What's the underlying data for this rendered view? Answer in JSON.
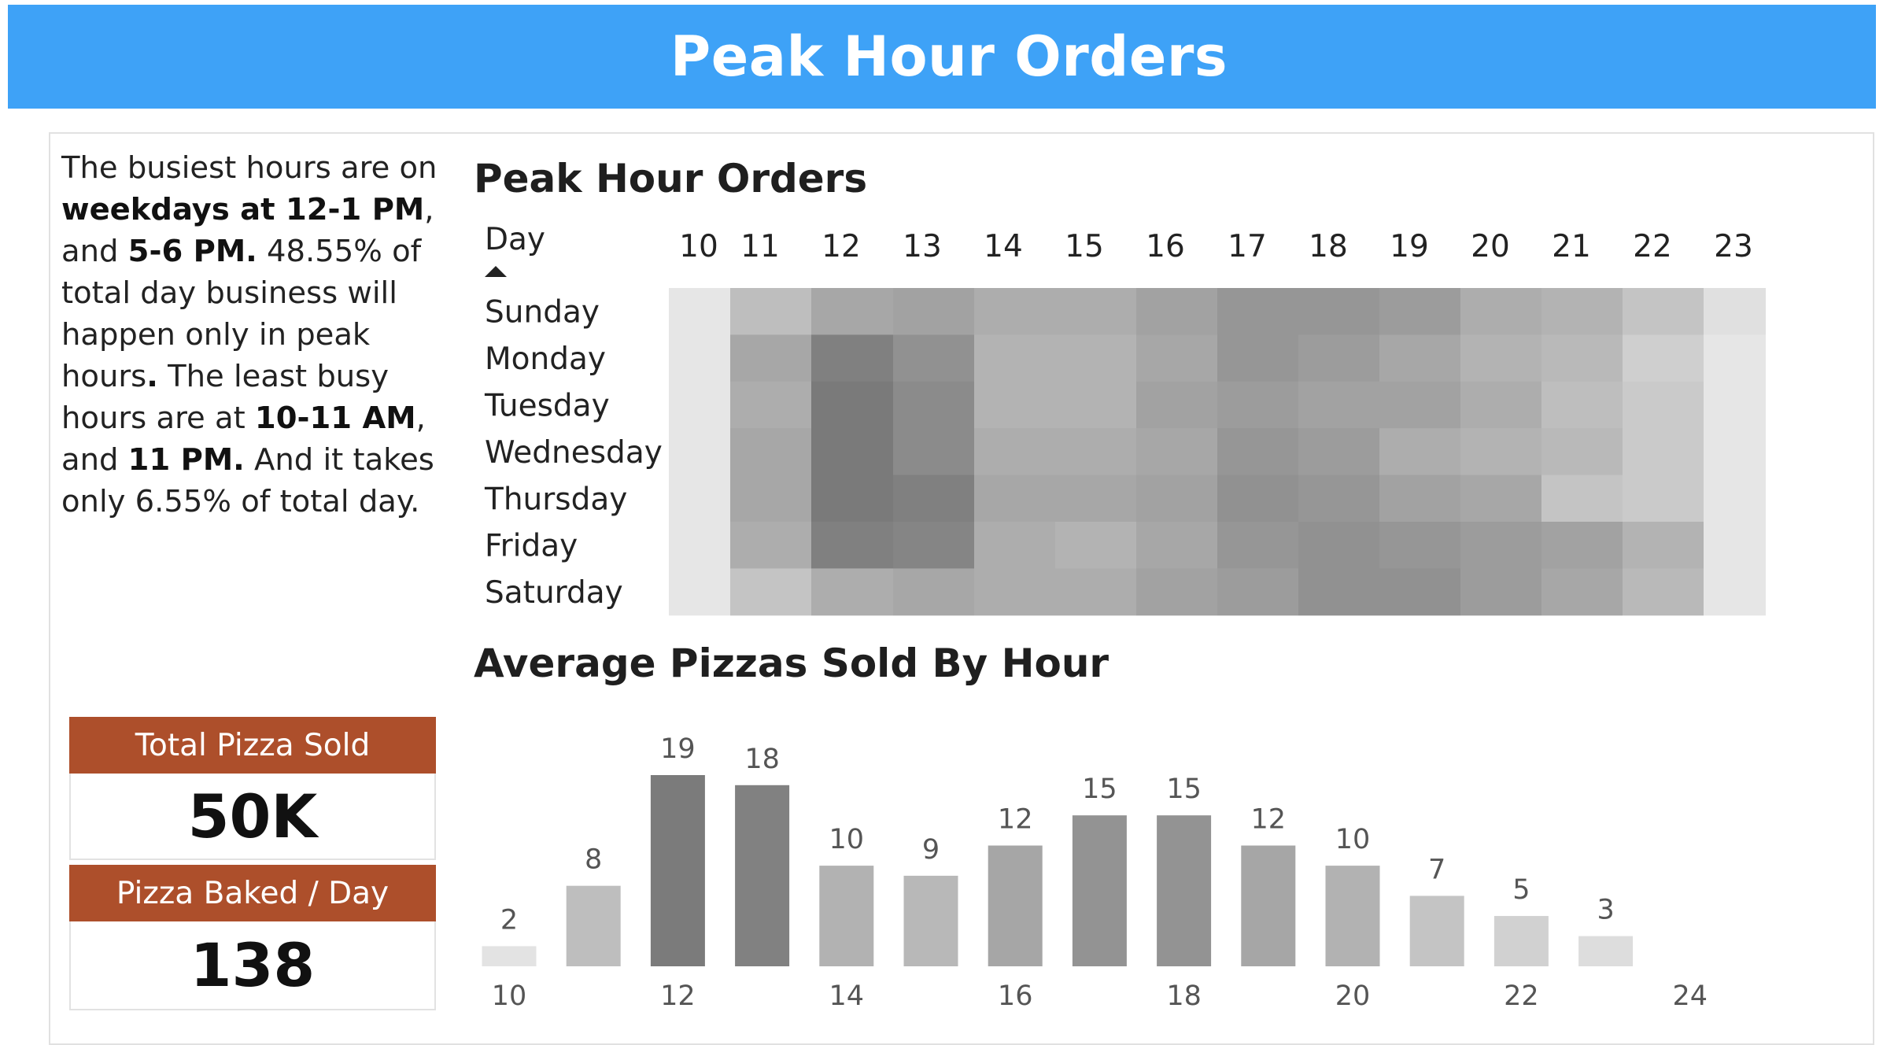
{
  "header": {
    "title": "Peak Hour Orders"
  },
  "insight": {
    "p1": "The busiest hours are on ",
    "b1": "weekdays at 12-1 PM",
    "p2": ", and ",
    "b2": "5-6 PM.",
    "p3": " 48.55% of total day business will happen only in peak hours",
    "b3": ".",
    "p4": " The least busy hours are at ",
    "b4": "10-11 AM",
    "p5": ", and ",
    "b5": "11 PM.",
    "p6": " And it takes only  6.55% of total day."
  },
  "kpis": [
    {
      "label": "Total Pizza Sold",
      "value": "50K"
    },
    {
      "label": "Pizza Baked / Day",
      "value": "138"
    }
  ],
  "chart_data": [
    {
      "type": "heatmap",
      "title": "Peak Hour Orders",
      "row_header": "Day",
      "sort": "ascending",
      "columns": [
        "10",
        "11",
        "12",
        "13",
        "14",
        "15",
        "16",
        "17",
        "18",
        "19",
        "20",
        "21",
        "22",
        "23"
      ],
      "rows": [
        "Sunday",
        "Monday",
        "Tuesday",
        "Wednesday",
        "Thursday",
        "Friday",
        "Saturday"
      ],
      "values": [
        [
          0.5,
          4.0,
          6.0,
          6.5,
          5.5,
          5.5,
          6.5,
          7.5,
          7.5,
          7.0,
          5.5,
          5.0,
          3.5,
          1.0
        ],
        [
          0.5,
          6.0,
          9.5,
          8.0,
          5.0,
          5.0,
          6.0,
          7.5,
          7.0,
          6.0,
          5.0,
          4.5,
          2.5,
          0.5
        ],
        [
          0.5,
          5.5,
          10.0,
          8.5,
          5.0,
          5.0,
          6.5,
          7.0,
          6.5,
          6.5,
          5.5,
          4.0,
          3.0,
          0.5
        ],
        [
          0.5,
          6.0,
          10.0,
          8.5,
          5.5,
          5.5,
          6.0,
          7.5,
          7.0,
          5.5,
          5.0,
          4.5,
          3.0,
          0.5
        ],
        [
          0.5,
          6.0,
          10.0,
          9.5,
          6.0,
          6.0,
          6.5,
          8.0,
          7.5,
          6.5,
          6.0,
          3.5,
          3.0,
          0.5
        ],
        [
          0.5,
          5.5,
          9.5,
          9.0,
          5.5,
          5.0,
          6.0,
          7.5,
          8.0,
          7.5,
          7.0,
          6.5,
          5.0,
          0.5
        ],
        [
          0.5,
          3.5,
          5.5,
          6.0,
          5.5,
          5.5,
          6.5,
          7.0,
          8.0,
          8.0,
          7.0,
          6.0,
          4.5,
          0.5
        ]
      ],
      "color_low": "#e6e6e6",
      "color_high": "#7a7a7a"
    },
    {
      "type": "bar",
      "title": "Average Pizzas Sold By Hour",
      "x": [
        10,
        11,
        12,
        13,
        14,
        15,
        16,
        17,
        18,
        19,
        20,
        21,
        22,
        23
      ],
      "values": [
        2,
        8,
        19,
        18,
        10,
        9,
        12,
        15,
        15,
        12,
        10,
        7,
        5,
        3
      ],
      "data_labels": [
        "2",
        "8",
        "19",
        "18",
        "10",
        "9",
        "12",
        "15",
        "15",
        "12",
        "10",
        "7",
        "5",
        "3"
      ],
      "xticks": [
        "10",
        "12",
        "14",
        "16",
        "18",
        "20",
        "22",
        "24"
      ],
      "xlim": [
        10,
        24
      ],
      "ylim": [
        0,
        19
      ],
      "color_low": "#e3e3e3",
      "color_high": "#7b7b7b"
    }
  ]
}
